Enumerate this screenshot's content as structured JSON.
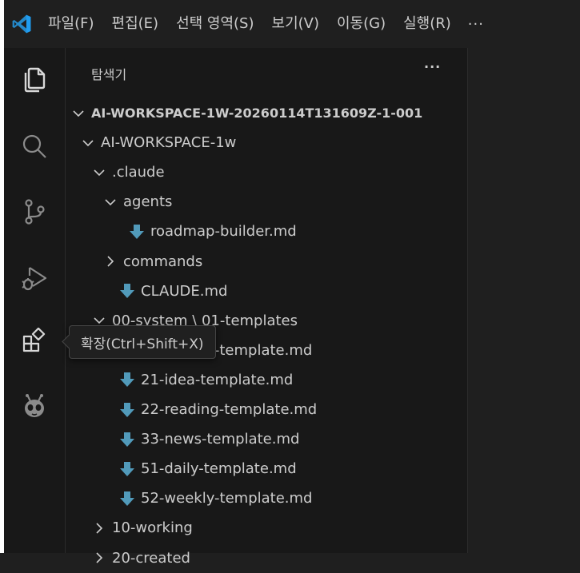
{
  "menubar": {
    "logo_icon": "vscode-logo-icon",
    "items": [
      {
        "label": "파일(F)"
      },
      {
        "label": "편집(E)"
      },
      {
        "label": "선택 영역(S)"
      },
      {
        "label": "보기(V)"
      },
      {
        "label": "이동(G)"
      },
      {
        "label": "실행(R)"
      }
    ],
    "more_label": "···"
  },
  "activity_bar": {
    "items": [
      {
        "name": "explorer",
        "icon": "files-icon",
        "active": true
      },
      {
        "name": "search",
        "icon": "search-icon"
      },
      {
        "name": "source-control",
        "icon": "source-control-icon"
      },
      {
        "name": "run-debug",
        "icon": "run-debug-icon"
      },
      {
        "name": "extensions",
        "icon": "extensions-icon"
      },
      {
        "name": "platformio",
        "icon": "alien-icon"
      }
    ]
  },
  "sidebar": {
    "title": "탐색기",
    "more_label": "···"
  },
  "tree": [
    {
      "label": "AI-WORKSPACE-1W-20260114T131609Z-1-001",
      "type": "folder",
      "expanded": true,
      "depth": 0
    },
    {
      "label": "AI-WORKSPACE-1w",
      "type": "folder",
      "expanded": true,
      "depth": 1
    },
    {
      "label": ".claude",
      "type": "folder",
      "expanded": true,
      "depth": 2
    },
    {
      "label": "agents",
      "type": "folder",
      "expanded": true,
      "depth": 3
    },
    {
      "label": "roadmap-builder.md",
      "type": "file",
      "depth": 4
    },
    {
      "label": "commands",
      "type": "folder",
      "expanded": false,
      "depth": 3
    },
    {
      "label": "CLAUDE.md",
      "type": "file",
      "depth": 3
    },
    {
      "label": "00-system \\ 01-templates",
      "type": "folder",
      "expanded": true,
      "depth": 2
    },
    {
      "label": "10-project-template.md",
      "type": "file",
      "depth": 3
    },
    {
      "label": "21-idea-template.md",
      "type": "file",
      "depth": 3
    },
    {
      "label": "22-reading-template.md",
      "type": "file",
      "depth": 3
    },
    {
      "label": "33-news-template.md",
      "type": "file",
      "depth": 3
    },
    {
      "label": "51-daily-template.md",
      "type": "file",
      "depth": 3
    },
    {
      "label": "52-weekly-template.md",
      "type": "file",
      "depth": 3
    },
    {
      "label": "10-working",
      "type": "folder",
      "expanded": false,
      "depth": 2
    },
    {
      "label": "20-created",
      "type": "folder",
      "expanded": false,
      "depth": 2
    }
  ],
  "tooltip": {
    "text": "확장(Ctrl+Shift+X)"
  },
  "colors": {
    "accent": "#0098ff",
    "md_icon": "#519aba",
    "text": "#cccccc",
    "background": "#181818"
  }
}
